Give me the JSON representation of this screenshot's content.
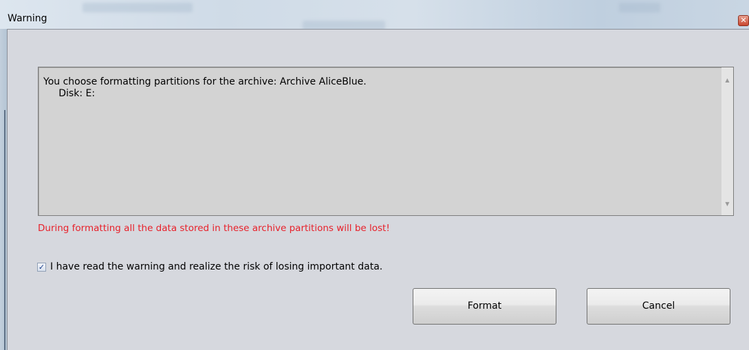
{
  "window": {
    "title": "Warning",
    "close_icon": "close-icon"
  },
  "message": {
    "line1": "You choose formatting partitions for the archive: Archive AliceBlue.",
    "line2": "     Disk: E:"
  },
  "warning": {
    "text": "During formatting all the data stored in these archive partitions will be lost!",
    "color": "#e8202a"
  },
  "confirm": {
    "label": "I have read the warning and realize the risk of losing important data.",
    "checked": true
  },
  "buttons": {
    "format_label": "Format",
    "cancel_label": "Cancel"
  }
}
